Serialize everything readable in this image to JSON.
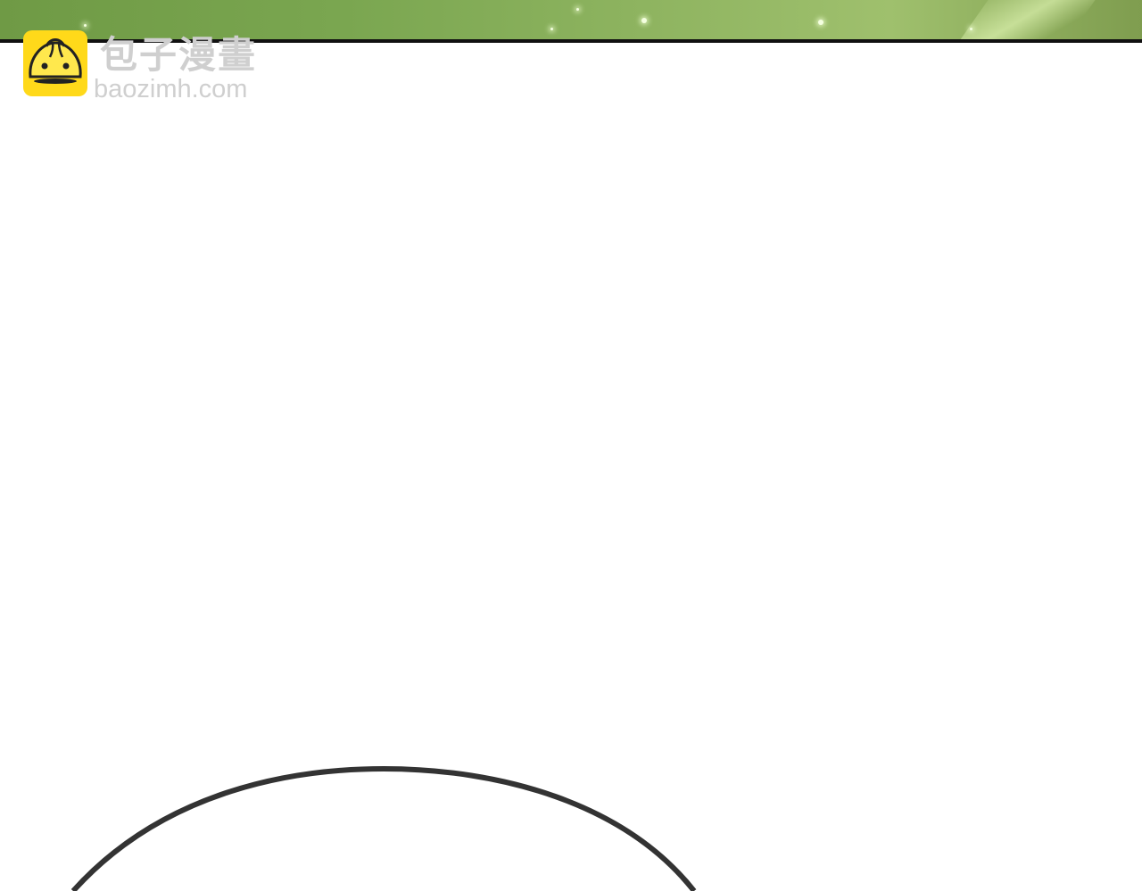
{
  "watermark": {
    "title": "包子漫畫",
    "url": "baozimh.com",
    "logo_icon": "steamed-bun-mascot-icon"
  },
  "colors": {
    "strip_green": "#8db35f",
    "logo_yellow": "#ffd91a",
    "watermark_gray": "#cfcfcf",
    "bubble_outline": "#333333"
  }
}
